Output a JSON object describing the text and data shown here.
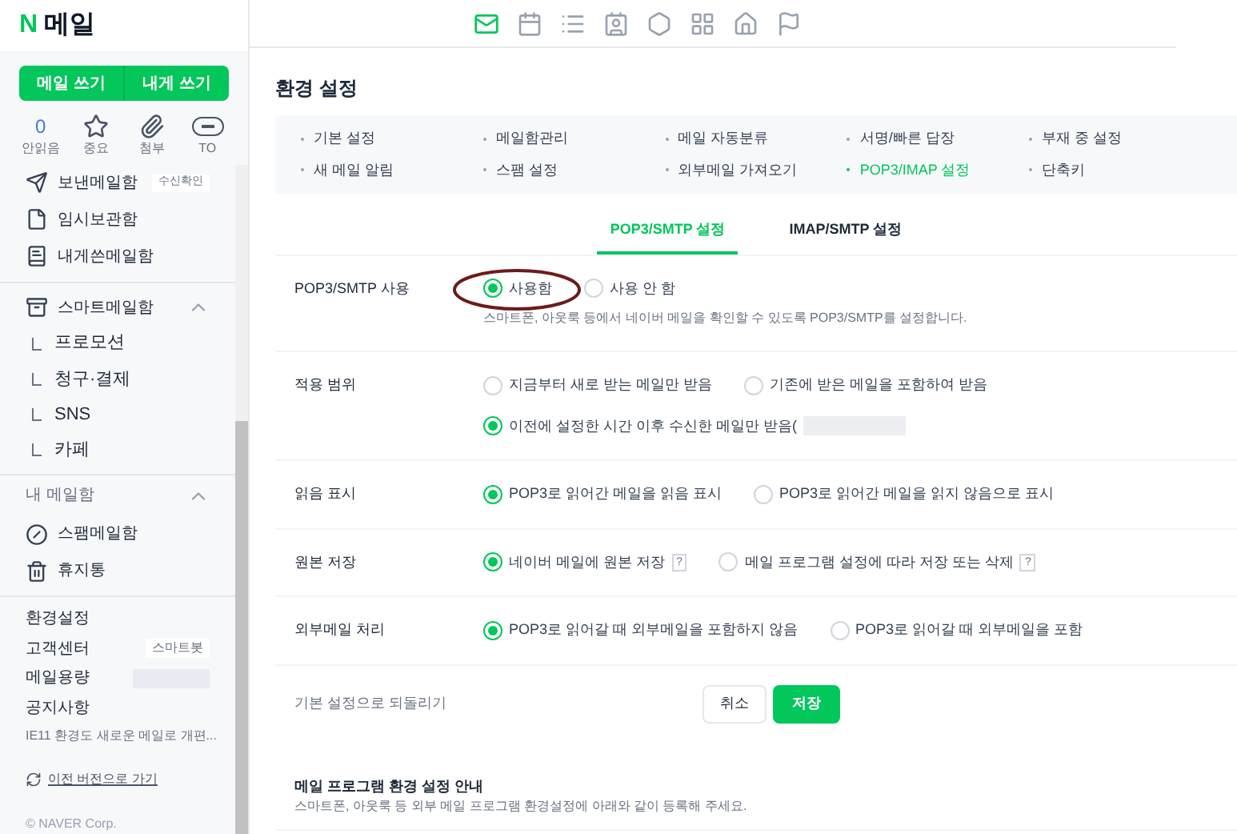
{
  "app": {
    "logo": "N",
    "title": "메일"
  },
  "top_icons": [
    {
      "kind": "mail",
      "selected": true
    },
    {
      "kind": "calendar",
      "selected": false
    },
    {
      "kind": "list",
      "selected": false
    },
    {
      "kind": "contact",
      "selected": false
    },
    {
      "kind": "hex",
      "selected": false
    },
    {
      "kind": "grid",
      "selected": false
    },
    {
      "kind": "home",
      "selected": false
    },
    {
      "kind": "flag",
      "selected": false
    }
  ],
  "sidebar": {
    "buttons": [
      "메일 쓰기",
      "내게 쓰기"
    ],
    "quick": [
      {
        "kind": "count",
        "count": "0",
        "label": "안읽음"
      },
      {
        "kind": "star",
        "label": "중요"
      },
      {
        "kind": "clip",
        "label": "첨부"
      },
      {
        "kind": "to",
        "label": "TO"
      }
    ],
    "folders": [
      {
        "kind": "sent",
        "label": "보낸메일함",
        "badge": "수신확인"
      },
      {
        "kind": "draft",
        "label": "임시보관함"
      },
      {
        "kind": "self",
        "label": "내게쓴메일함"
      }
    ],
    "smart": {
      "label": "스마트메일함",
      "expanded": true,
      "children": [
        {
          "label": "프로모션"
        },
        {
          "label": "청구·결제"
        },
        {
          "label": "SNS"
        },
        {
          "label": "카페"
        }
      ]
    },
    "my_mailbox": {
      "label": "내 메일함",
      "expanded": true
    },
    "folders2": [
      {
        "kind": "spam",
        "label": "스팸메일함"
      },
      {
        "kind": "trash",
        "label": "휴지통"
      }
    ],
    "links": [
      {
        "label": "환경설정"
      },
      {
        "label": "고객센터",
        "badge": "스마트봇"
      },
      {
        "label": "메일용량",
        "redacted": true
      },
      {
        "label": "공지사항"
      }
    ],
    "notice": "IE11 환경도 새로운 메일로 개편...",
    "old_version": "이전 버전으로 가기",
    "copyright": "© NAVER Corp."
  },
  "settings": {
    "title": "환경 설정",
    "menu": [
      {
        "label": "기본 설정",
        "selected": false
      },
      {
        "label": "메일함관리",
        "selected": false
      },
      {
        "label": "메일 자동분류",
        "selected": false
      },
      {
        "label": "서명/빠른 답장",
        "selected": false
      },
      {
        "label": "부재 중 설정",
        "selected": false
      },
      {
        "label": "새 메일 알림",
        "selected": false
      },
      {
        "label": "스팸 설정",
        "selected": false
      },
      {
        "label": "외부메일 가져오기",
        "selected": false
      },
      {
        "label": "POP3/IMAP 설정",
        "selected": true
      },
      {
        "label": "단축키",
        "selected": false
      }
    ],
    "subtabs": [
      {
        "label": "POP3/SMTP 설정",
        "selected": true
      },
      {
        "label": "IMAP/SMTP 설정",
        "selected": false
      }
    ],
    "rows": [
      {
        "label": "POP3/SMTP 사용",
        "options": [
          {
            "label": "사용함",
            "selected": true
          },
          {
            "label": "사용 안 함",
            "selected": false
          }
        ],
        "note": "스마트폰, 아웃룩 등에서 네이버 메일을 확인할 수 있도록 POP3/SMTP를 설정합니다."
      },
      {
        "label": "적용 범위",
        "options": [
          {
            "label": "지금부터 새로 받는 메일만 받음",
            "selected": false
          },
          {
            "label": "기존에 받은 메일을 포함하여 받음",
            "selected": false
          },
          {
            "label": "이전에 설정한 시간 이후 수신한 메일만 받음(",
            "selected": true,
            "redacted": true
          }
        ]
      },
      {
        "label": "읽음 표시",
        "options": [
          {
            "label": "POP3로 읽어간 메일을 읽음 표시",
            "selected": true
          },
          {
            "label": "POP3로 읽어간 메일을 읽지 않음으로 표시",
            "selected": false
          }
        ]
      },
      {
        "label": "원본 저장",
        "options": [
          {
            "label": "네이버 메일에 원본 저장",
            "selected": true,
            "help": "?"
          },
          {
            "label": "메일 프로그램 설정에 따라 저장 또는 삭제",
            "selected": false,
            "help": "?"
          }
        ]
      },
      {
        "label": "외부메일 처리",
        "options": [
          {
            "label": "POP3로 읽어갈 때 외부메일을 포함하지 않음",
            "selected": true
          },
          {
            "label": "POP3로 읽어갈 때 외부메일을 포함",
            "selected": false
          }
        ]
      }
    ],
    "reset": "기본 설정으로 되돌리기",
    "cancel": "취소",
    "save": "저장",
    "guide": {
      "title": "메일 프로그램 환경 설정 안내",
      "text": "스마트폰, 아웃룩 등 외부 메일 프로그램 환경설정에 아래와 같이 등록해 주세요."
    }
  }
}
